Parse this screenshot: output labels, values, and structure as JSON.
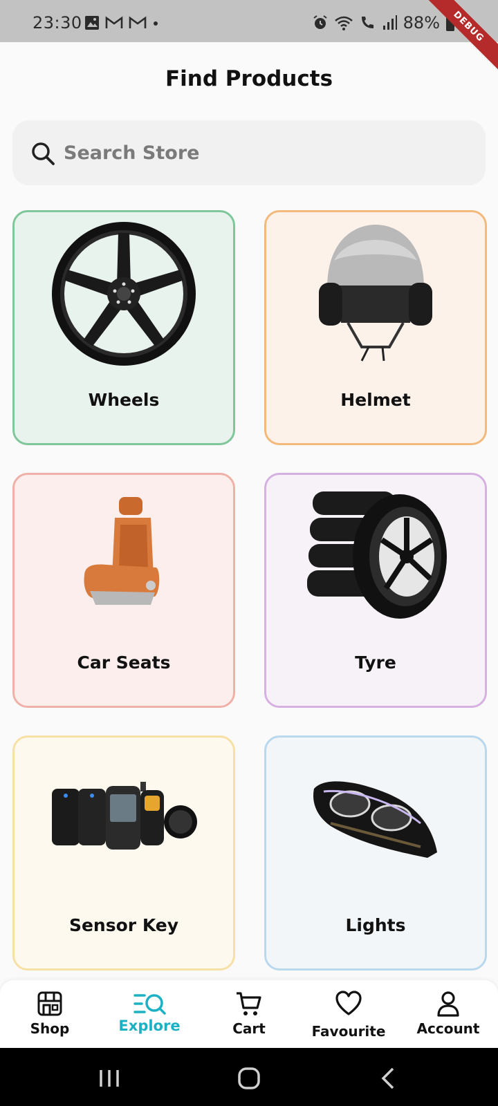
{
  "status_bar": {
    "time": "23:30",
    "battery": "88%",
    "icons": [
      "image-icon",
      "gmail-icon",
      "gmail-icon",
      "dot-icon",
      "alarm-icon",
      "wifi-icon",
      "wifi-call-icon",
      "signal-icon",
      "battery-icon"
    ],
    "debug_banner": "DEBUG"
  },
  "header": {
    "title": "Find Products"
  },
  "search": {
    "placeholder": "Search Store"
  },
  "categories": [
    {
      "label": "Wheels",
      "image": "alloy-wheel-image",
      "bg": "#e9f3ee",
      "border": "#7fc79a"
    },
    {
      "label": "Helmet",
      "image": "helmet-image",
      "bg": "#fcf2ea",
      "border": "#f3b97c"
    },
    {
      "label": "Car Seats",
      "image": "car-seat-image",
      "bg": "#fbeeec",
      "border": "#efb1a7"
    },
    {
      "label": "Tyre",
      "image": "tyre-stack-image",
      "bg": "#f7f1f8",
      "border": "#d5b0e0"
    },
    {
      "label": "Sensor Key",
      "image": "remote-keys-image",
      "bg": "#fdf9ef",
      "border": "#f6e0a3"
    },
    {
      "label": "Lights",
      "image": "headlight-image",
      "bg": "#f3f6f9",
      "border": "#b9d8ed"
    }
  ],
  "bottom_nav": {
    "active": "Explore",
    "accent": "#1bb1c5",
    "items": [
      {
        "label": "Shop",
        "icon": "store-icon"
      },
      {
        "label": "Explore",
        "icon": "explore-icon"
      },
      {
        "label": "Cart",
        "icon": "cart-icon"
      },
      {
        "label": "Favourite",
        "icon": "heart-icon"
      },
      {
        "label": "Account",
        "icon": "person-icon"
      }
    ]
  }
}
